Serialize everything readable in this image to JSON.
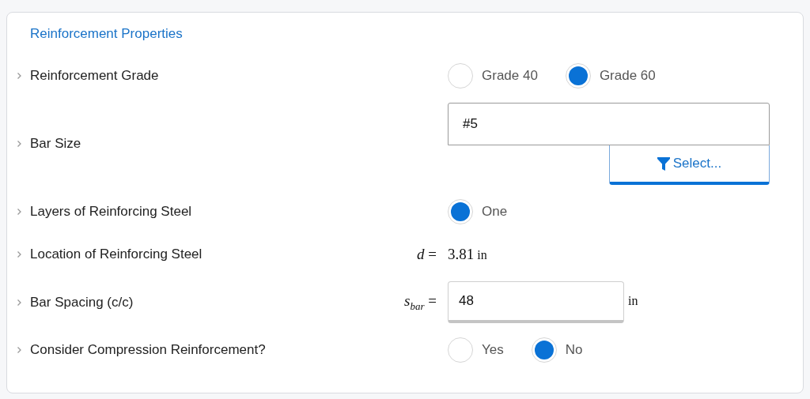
{
  "panel": {
    "title": "Reinforcement Properties"
  },
  "rows": [
    {
      "kind": "radio",
      "label": "Reinforcement Grade",
      "options": [
        {
          "label": "Grade 40",
          "selected": false
        },
        {
          "label": "Grade 60",
          "selected": true
        }
      ]
    },
    {
      "kind": "select",
      "label": "Bar Size",
      "value": "#5",
      "button": "Select..."
    },
    {
      "kind": "radio",
      "label": "Layers of Reinforcing Steel",
      "options": [
        {
          "label": "One",
          "selected": true
        }
      ]
    },
    {
      "kind": "static",
      "label": "Location of Reinforcing Steel",
      "symbol": "*d* =",
      "value": "3.81",
      "unit": "in"
    },
    {
      "kind": "input",
      "label": "Bar Spacing (c/c)",
      "symbol": "*s*$_{bar}$ =",
      "value": "48",
      "unit": "in"
    },
    {
      "kind": "radio",
      "label": "Consider Compression Reinforcement?",
      "options": [
        {
          "label": "Yes",
          "selected": false
        },
        {
          "label": "No",
          "selected": true
        }
      ]
    }
  ]
}
